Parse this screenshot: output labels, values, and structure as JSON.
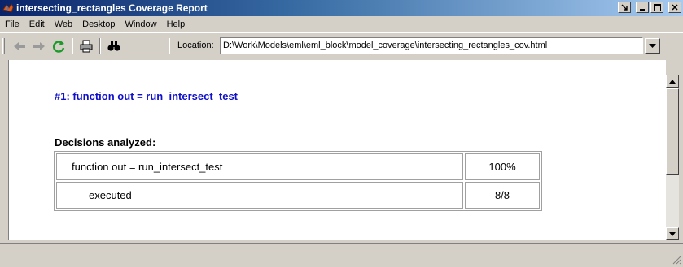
{
  "window": {
    "title": "intersecting_rectangles Coverage Report",
    "icon": "matlab-logo-icon",
    "buttons": [
      "dock-icon",
      "minimize-icon",
      "maximize-icon",
      "close-icon"
    ]
  },
  "menu": {
    "items": [
      "File",
      "Edit",
      "Web",
      "Desktop",
      "Window",
      "Help"
    ]
  },
  "toolbar": {
    "tools": [
      "back-arrow-icon",
      "forward-arrow-icon",
      "refresh-icon",
      "print-icon",
      "find-binoculars-icon"
    ],
    "location_label": "Location:",
    "location_value": "D:\\Work\\Models\\eml\\eml_block\\model_coverage\\intersecting_rectangles_cov.html"
  },
  "report": {
    "heading_link": "#1: function out = run_intersect_test",
    "decisions_label": "Decisions analyzed:",
    "rows": [
      {
        "name": "function out = run_intersect_test",
        "value": "100%"
      },
      {
        "name": "executed",
        "value": "8/8"
      }
    ]
  },
  "colors": {
    "titlebar_start": "#0a246a",
    "titlebar_end": "#a6caf0",
    "link": "#1010cc",
    "chrome": "#d4d0c8"
  }
}
